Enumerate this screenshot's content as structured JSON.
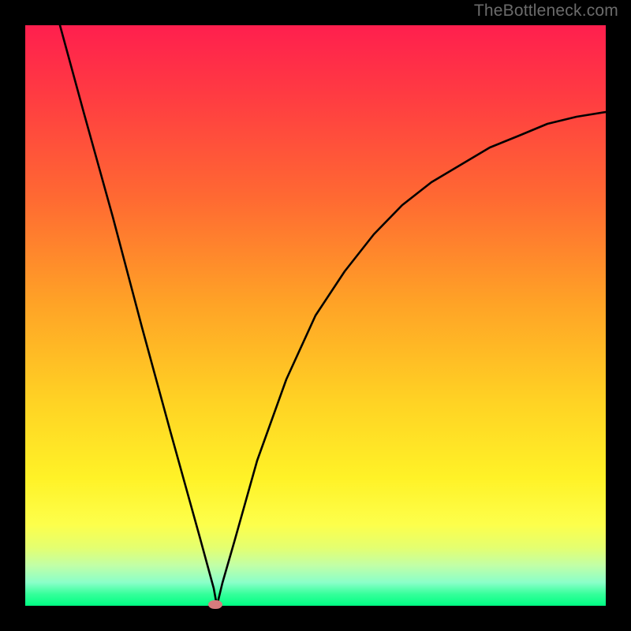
{
  "watermark": "TheBottleneck.com",
  "colors": {
    "background": "#000000",
    "gradient_top": "#ff1f4e",
    "gradient_bottom": "#00ff84",
    "curve": "#000000",
    "marker": "#d67b7d",
    "watermark": "#6b6b6b"
  },
  "chart_data": {
    "type": "line",
    "title": "",
    "xlabel": "",
    "ylabel": "",
    "xlim": [
      0,
      100
    ],
    "ylim": [
      0,
      100
    ],
    "series": [
      {
        "name": "curve",
        "x": [
          6,
          10,
          15,
          20,
          25,
          30,
          32.5,
          33,
          34,
          36,
          40,
          45,
          50,
          55,
          60,
          65,
          70,
          75,
          80,
          85,
          90,
          95,
          100
        ],
        "y": [
          100,
          85,
          67,
          48,
          30,
          12,
          3,
          0,
          4,
          11,
          25,
          39,
          50,
          58,
          64,
          69,
          73,
          76,
          79,
          81,
          83,
          84,
          85
        ]
      }
    ],
    "marker": {
      "x": 33,
      "y": 0
    },
    "grid": false,
    "legend": false
  }
}
